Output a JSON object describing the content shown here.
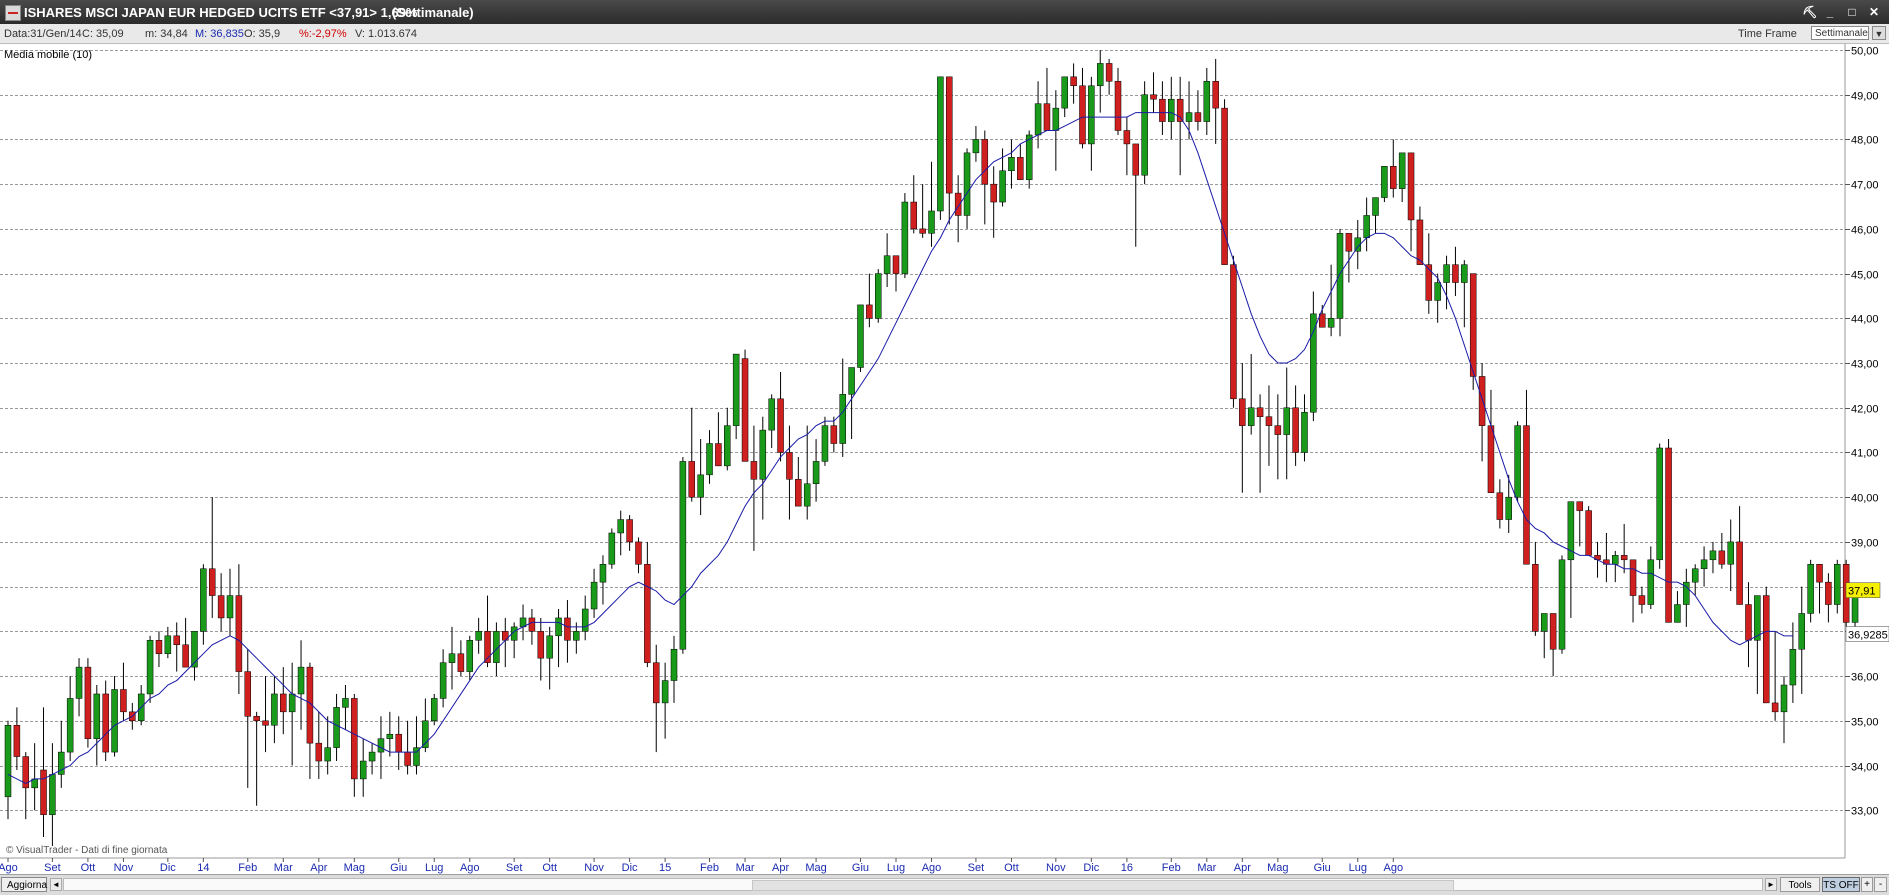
{
  "window": {
    "title": "ISHARES MSCI JAPAN EUR HEDGED UCITS ETF <37,91> 1,69%",
    "timeframe": "(Settimanale)",
    "buttons": {
      "tools": "⛏",
      "minimize": "_",
      "maximize": "□",
      "close": "✕"
    }
  },
  "infobar": {
    "date": "Data:31/Gen/14",
    "close": "C: 35,09",
    "min": "m: 34,84",
    "max": "M: 36,835",
    "open": "O: 35,9",
    "change": "%:-2,97%",
    "volume": "V: 1.013.674",
    "timeframe_label": "Time Frame",
    "timeframe_value": "Settimanale",
    "dropdown_icon": "▼"
  },
  "indicator_label": "Media mobile (10)",
  "watermark": "© VisualTrader - Dati di fine giornata",
  "bottombar": {
    "refresh": "Aggiorna",
    "tools": "Tools",
    "ts_off": "TS OFF",
    "plus": "+",
    "minus": "-",
    "scroll_left": "◄",
    "scroll_right": "►"
  },
  "colors": {
    "up": "#1a9a1a",
    "down": "#d01f1f",
    "ma": "#1a1aa8",
    "grid": "#9a9a9a",
    "last_price_bg": "#f5ef00"
  },
  "chart_data": {
    "type": "candlestick",
    "series_name": "Media mobile (10)",
    "ylim": [
      32.2,
      50.0
    ],
    "y_ticks": [
      "33,00",
      "34,00",
      "35,00",
      "36,00",
      "37,00",
      "38,00",
      "39,00",
      "40,00",
      "41,00",
      "42,00",
      "43,00",
      "44,00",
      "45,00",
      "46,00",
      "47,00",
      "48,00",
      "49,00",
      "50,00"
    ],
    "x_labels": [
      "Ago",
      "Set",
      "Ott",
      "Nov",
      "Dic",
      "14",
      "Feb",
      "Mar",
      "Apr",
      "Mag",
      "Giu",
      "Lug",
      "Ago",
      "Set",
      "Ott",
      "Nov",
      "Dic",
      "15",
      "Feb",
      "Mar",
      "Apr",
      "Mag",
      "Giu",
      "Lug",
      "Ago",
      "Set",
      "Ott",
      "Nov",
      "Dic",
      "16",
      "Feb",
      "Mar",
      "Apr",
      "Mag",
      "Giu",
      "Lug",
      "Ago"
    ],
    "x_label_index": [
      0,
      5,
      9,
      13,
      18,
      22,
      27,
      31,
      35,
      39,
      44,
      48,
      52,
      57,
      61,
      66,
      70,
      74,
      79,
      83,
      87,
      91,
      96,
      100,
      104,
      109,
      113,
      118,
      122,
      126,
      131,
      135,
      139,
      143,
      148,
      152,
      156
    ],
    "last_price_label": "37,91",
    "ma_label": "36,9285",
    "last_price": 37.91,
    "ma_last": 36.9285,
    "candles": [
      [
        33.3,
        35.0,
        32.8,
        34.9
      ],
      [
        34.9,
        35.3,
        33.9,
        34.2
      ],
      [
        34.2,
        34.3,
        32.8,
        33.5
      ],
      [
        33.5,
        34.5,
        33.0,
        33.7
      ],
      [
        33.9,
        35.3,
        32.4,
        32.9
      ],
      [
        32.9,
        34.5,
        32.2,
        33.8
      ],
      [
        33.8,
        35.0,
        33.5,
        34.3
      ],
      [
        34.3,
        36.0,
        34.1,
        35.5
      ],
      [
        35.5,
        36.4,
        35.1,
        36.2
      ],
      [
        36.2,
        36.4,
        34.4,
        34.6
      ],
      [
        34.6,
        35.8,
        34.0,
        35.6
      ],
      [
        35.6,
        35.9,
        34.1,
        34.3
      ],
      [
        34.3,
        36.0,
        34.2,
        35.7
      ],
      [
        35.7,
        36.3,
        35.0,
        35.2
      ],
      [
        35.2,
        35.4,
        34.8,
        35.0
      ],
      [
        35.0,
        35.8,
        34.9,
        35.6
      ],
      [
        35.6,
        36.9,
        35.4,
        36.8
      ],
      [
        36.8,
        37.0,
        36.2,
        36.5
      ],
      [
        36.5,
        37.1,
        36.4,
        36.9
      ],
      [
        36.9,
        37.2,
        36.1,
        36.7
      ],
      [
        36.7,
        37.3,
        36.3,
        36.2
      ],
      [
        36.2,
        37.0,
        35.9,
        37.0
      ],
      [
        37.0,
        38.5,
        36.7,
        38.4
      ],
      [
        38.4,
        40.0,
        37.3,
        37.8
      ],
      [
        37.8,
        38.3,
        37.0,
        37.3
      ],
      [
        37.3,
        38.4,
        36.9,
        37.8
      ],
      [
        37.8,
        38.5,
        35.6,
        36.1
      ],
      [
        36.1,
        36.6,
        33.5,
        35.1
      ],
      [
        35.1,
        35.2,
        33.1,
        35.0
      ],
      [
        35.0,
        36.0,
        34.3,
        34.9
      ],
      [
        34.9,
        36.0,
        34.5,
        35.6
      ],
      [
        35.6,
        36.2,
        34.7,
        35.2
      ],
      [
        35.2,
        36.3,
        34.0,
        35.6
      ],
      [
        35.6,
        36.8,
        34.8,
        36.2
      ],
      [
        36.2,
        36.3,
        33.7,
        34.5
      ],
      [
        34.5,
        35.2,
        33.7,
        34.1
      ],
      [
        34.1,
        35.1,
        33.8,
        34.4
      ],
      [
        34.4,
        35.6,
        34.1,
        35.3
      ],
      [
        35.3,
        35.8,
        34.8,
        35.5
      ],
      [
        35.5,
        35.6,
        33.3,
        33.7
      ],
      [
        33.7,
        34.6,
        33.3,
        34.1
      ],
      [
        34.1,
        34.5,
        33.8,
        34.3
      ],
      [
        34.3,
        35.1,
        33.7,
        34.6
      ],
      [
        34.6,
        35.2,
        34.2,
        34.7
      ],
      [
        34.7,
        35.1,
        33.9,
        34.3
      ],
      [
        34.3,
        35.0,
        33.8,
        34.0
      ],
      [
        34.0,
        35.1,
        33.8,
        34.4
      ],
      [
        34.4,
        35.5,
        34.3,
        35.0
      ],
      [
        35.0,
        35.6,
        34.9,
        35.5
      ],
      [
        35.5,
        36.6,
        35.3,
        36.3
      ],
      [
        36.3,
        37.1,
        35.7,
        36.5
      ],
      [
        36.5,
        36.8,
        36.0,
        36.1
      ],
      [
        36.1,
        36.9,
        35.9,
        36.8
      ],
      [
        36.8,
        37.3,
        36.5,
        37.0
      ],
      [
        37.0,
        37.8,
        36.2,
        36.3
      ],
      [
        36.3,
        37.2,
        36.0,
        37.0
      ],
      [
        37.0,
        37.3,
        36.2,
        36.8
      ],
      [
        36.8,
        37.2,
        36.4,
        37.1
      ],
      [
        37.1,
        37.6,
        36.8,
        37.3
      ],
      [
        37.3,
        37.5,
        36.7,
        37.0
      ],
      [
        37.0,
        37.3,
        35.9,
        36.4
      ],
      [
        36.4,
        37.1,
        35.7,
        36.9
      ],
      [
        36.9,
        37.5,
        36.2,
        37.3
      ],
      [
        37.3,
        37.7,
        36.3,
        36.8
      ],
      [
        36.8,
        37.2,
        36.5,
        37.0
      ],
      [
        37.0,
        37.8,
        36.8,
        37.5
      ],
      [
        37.5,
        38.4,
        37.3,
        38.1
      ],
      [
        38.1,
        38.7,
        37.6,
        38.5
      ],
      [
        38.5,
        39.3,
        38.4,
        39.2
      ],
      [
        39.2,
        39.7,
        38.7,
        39.5
      ],
      [
        39.5,
        39.6,
        38.8,
        39.0
      ],
      [
        39.0,
        39.1,
        38.3,
        38.5
      ],
      [
        38.5,
        39.0,
        36.2,
        36.3
      ],
      [
        36.3,
        36.7,
        34.3,
        35.4
      ],
      [
        35.4,
        36.3,
        34.6,
        35.9
      ],
      [
        35.9,
        36.9,
        35.4,
        36.6
      ],
      [
        36.6,
        40.9,
        36.5,
        40.8
      ],
      [
        40.8,
        42.0,
        39.9,
        40.0
      ],
      [
        40.0,
        41.3,
        39.6,
        40.5
      ],
      [
        40.5,
        41.5,
        40.3,
        41.2
      ],
      [
        41.2,
        41.9,
        40.7,
        40.7
      ],
      [
        40.7,
        42.0,
        40.6,
        41.6
      ],
      [
        41.6,
        43.1,
        41.3,
        43.2
      ],
      [
        43.1,
        43.3,
        41.0,
        40.8
      ],
      [
        40.8,
        41.6,
        38.8,
        40.4
      ],
      [
        40.4,
        41.8,
        39.5,
        41.5
      ],
      [
        41.5,
        42.3,
        41.1,
        42.2
      ],
      [
        42.2,
        42.8,
        40.8,
        41.0
      ],
      [
        41.0,
        41.6,
        39.5,
        40.4
      ],
      [
        40.4,
        40.9,
        39.9,
        39.8
      ],
      [
        39.8,
        41.6,
        39.5,
        40.3
      ],
      [
        40.3,
        41.3,
        39.9,
        40.8
      ],
      [
        40.8,
        41.8,
        40.7,
        41.6
      ],
      [
        41.6,
        41.8,
        41.0,
        41.2
      ],
      [
        41.2,
        43.1,
        40.9,
        42.3
      ],
      [
        42.3,
        42.6,
        41.3,
        42.9
      ],
      [
        42.9,
        44.3,
        42.8,
        44.3
      ],
      [
        44.3,
        45.0,
        43.8,
        44.0
      ],
      [
        44.0,
        45.1,
        43.9,
        45.0
      ],
      [
        45.0,
        45.9,
        44.7,
        45.4
      ],
      [
        45.4,
        45.3,
        44.6,
        45.0
      ],
      [
        45.0,
        46.8,
        44.9,
        46.6
      ],
      [
        46.6,
        47.2,
        45.9,
        46.0
      ],
      [
        46.0,
        47.0,
        45.8,
        45.9
      ],
      [
        45.9,
        47.5,
        45.6,
        46.4
      ],
      [
        46.4,
        49.4,
        46.2,
        49.4
      ],
      [
        49.4,
        47.1,
        46.1,
        46.8
      ],
      [
        46.8,
        47.2,
        45.7,
        46.3
      ],
      [
        46.3,
        47.8,
        46.0,
        47.7
      ],
      [
        47.7,
        48.3,
        47.5,
        48.0
      ],
      [
        48.0,
        48.2,
        46.1,
        47.0
      ],
      [
        47.0,
        47.4,
        45.8,
        46.6
      ],
      [
        46.6,
        47.8,
        46.5,
        47.3
      ],
      [
        47.3,
        48.0,
        46.9,
        47.6
      ],
      [
        47.6,
        47.9,
        47.1,
        47.1
      ],
      [
        47.1,
        48.2,
        46.9,
        48.1
      ],
      [
        48.1,
        49.3,
        47.8,
        48.8
      ],
      [
        48.8,
        49.6,
        48.2,
        48.2
      ],
      [
        48.2,
        49.1,
        47.3,
        48.7
      ],
      [
        48.7,
        49.4,
        48.5,
        49.4
      ],
      [
        49.4,
        49.7,
        48.8,
        49.2
      ],
      [
        49.2,
        49.6,
        47.8,
        47.9
      ],
      [
        47.9,
        49.4,
        47.3,
        49.2
      ],
      [
        49.2,
        50.0,
        48.6,
        49.7
      ],
      [
        49.7,
        49.8,
        49.0,
        49.3
      ],
      [
        49.3,
        49.6,
        48.1,
        48.2
      ],
      [
        48.2,
        48.5,
        47.2,
        47.9
      ],
      [
        47.9,
        47.5,
        45.6,
        47.2
      ],
      [
        47.2,
        49.3,
        47.0,
        49.0
      ],
      [
        49.0,
        49.5,
        48.6,
        48.9
      ],
      [
        48.9,
        49.3,
        48.1,
        48.4
      ],
      [
        48.4,
        49.4,
        48.0,
        48.9
      ],
      [
        48.9,
        49.4,
        47.2,
        48.4
      ],
      [
        48.4,
        49.3,
        48.0,
        48.6
      ],
      [
        48.6,
        49.1,
        48.2,
        48.4
      ],
      [
        48.4,
        49.6,
        48.1,
        49.3
      ],
      [
        49.3,
        49.8,
        47.9,
        48.7
      ],
      [
        48.7,
        48.9,
        45.4,
        45.2
      ],
      [
        45.2,
        45.4,
        42.0,
        42.2
      ],
      [
        42.2,
        43.0,
        40.1,
        41.6
      ],
      [
        41.6,
        43.2,
        41.4,
        42.0
      ],
      [
        42.0,
        42.3,
        40.1,
        41.8
      ],
      [
        41.8,
        42.5,
        40.7,
        41.6
      ],
      [
        41.6,
        42.3,
        40.4,
        41.4
      ],
      [
        41.4,
        42.9,
        40.4,
        42.0
      ],
      [
        42.0,
        42.5,
        40.7,
        41.0
      ],
      [
        41.0,
        42.3,
        40.8,
        41.9
      ],
      [
        41.9,
        44.6,
        41.7,
        44.1
      ],
      [
        44.1,
        44.3,
        43.8,
        43.8
      ],
      [
        43.8,
        45.2,
        43.6,
        44.0
      ],
      [
        44.0,
        46.0,
        43.6,
        45.9
      ],
      [
        45.9,
        45.2,
        44.8,
        45.5
      ],
      [
        45.5,
        46.2,
        45.1,
        45.8
      ],
      [
        45.8,
        46.7,
        45.5,
        46.3
      ],
      [
        46.3,
        46.4,
        45.9,
        46.7
      ],
      [
        46.7,
        47.3,
        46.6,
        47.4
      ],
      [
        47.4,
        48.0,
        46.7,
        46.9
      ],
      [
        46.9,
        47.7,
        46.6,
        47.7
      ],
      [
        47.7,
        47.6,
        45.5,
        46.2
      ],
      [
        46.2,
        46.5,
        45.5,
        45.2
      ],
      [
        45.2,
        45.9,
        44.1,
        44.4
      ],
      [
        44.4,
        45.0,
        43.9,
        44.8
      ],
      [
        44.8,
        45.4,
        44.2,
        45.2
      ],
      [
        45.2,
        45.6,
        44.5,
        44.8
      ],
      [
        44.8,
        45.3,
        43.8,
        45.2
      ],
      [
        45.0,
        44.6,
        42.4,
        42.7
      ],
      [
        42.7,
        43.0,
        40.8,
        41.6
      ],
      [
        41.6,
        42.4,
        40.3,
        40.1
      ],
      [
        40.1,
        40.4,
        39.3,
        39.5
      ],
      [
        39.5,
        40.5,
        39.2,
        40.0
      ],
      [
        40.0,
        41.7,
        39.9,
        41.6
      ],
      [
        41.6,
        42.4,
        38.8,
        38.5
      ],
      [
        38.5,
        39.0,
        36.9,
        37.0
      ],
      [
        37.0,
        37.4,
        36.4,
        37.4
      ],
      [
        37.4,
        37.3,
        36.0,
        36.6
      ],
      [
        36.6,
        38.7,
        36.5,
        38.6
      ],
      [
        38.6,
        39.9,
        37.3,
        39.9
      ],
      [
        39.9,
        39.4,
        38.9,
        39.7
      ],
      [
        39.7,
        39.8,
        38.8,
        38.7
      ],
      [
        38.7,
        39.0,
        38.2,
        38.6
      ],
      [
        38.6,
        39.2,
        38.1,
        38.5
      ],
      [
        38.5,
        38.8,
        38.1,
        38.7
      ],
      [
        38.7,
        39.4,
        38.3,
        38.6
      ],
      [
        38.6,
        38.5,
        37.2,
        37.8
      ],
      [
        37.8,
        38.0,
        37.4,
        37.6
      ],
      [
        37.6,
        38.9,
        37.5,
        38.6
      ],
      [
        38.6,
        41.2,
        38.4,
        41.1
      ],
      [
        41.1,
        41.3,
        37.8,
        37.2
      ],
      [
        37.2,
        37.9,
        37.3,
        37.6
      ],
      [
        37.6,
        38.4,
        37.1,
        38.1
      ],
      [
        38.1,
        38.5,
        37.8,
        38.4
      ],
      [
        38.4,
        38.9,
        38.0,
        38.6
      ],
      [
        38.6,
        39.0,
        38.3,
        38.8
      ],
      [
        38.8,
        39.2,
        38.4,
        38.5
      ],
      [
        38.5,
        39.5,
        37.9,
        39.0
      ],
      [
        39.0,
        39.8,
        37.7,
        37.6
      ],
      [
        37.6,
        38.1,
        36.2,
        36.8
      ],
      [
        36.8,
        37.6,
        35.6,
        37.8
      ],
      [
        37.8,
        38.0,
        35.5,
        35.4
      ],
      [
        35.4,
        37.0,
        35.0,
        35.2
      ],
      [
        35.2,
        36.0,
        34.5,
        35.8
      ],
      [
        35.8,
        37.2,
        35.4,
        36.6
      ],
      [
        36.6,
        38.0,
        35.6,
        37.4
      ],
      [
        37.4,
        38.6,
        37.2,
        38.5
      ],
      [
        38.5,
        38.4,
        37.4,
        38.1
      ],
      [
        38.1,
        38.3,
        37.2,
        37.6
      ],
      [
        37.6,
        38.6,
        37.4,
        38.5
      ],
      [
        38.5,
        38.6,
        37.1,
        37.2
      ],
      [
        37.2,
        38.0,
        37.1,
        37.91
      ]
    ],
    "ma": [
      33.8,
      33.7,
      33.6,
      33.7,
      33.7,
      33.8,
      33.9,
      34.0,
      34.2,
      34.3,
      34.5,
      34.7,
      34.9,
      35.0,
      35.1,
      35.3,
      35.5,
      35.6,
      35.8,
      35.9,
      36.1,
      36.3,
      36.5,
      36.7,
      36.8,
      36.9,
      36.8,
      36.6,
      36.4,
      36.2,
      36.0,
      35.8,
      35.6,
      35.5,
      35.4,
      35.2,
      35.0,
      34.9,
      34.8,
      34.7,
      34.6,
      34.5,
      34.4,
      34.3,
      34.3,
      34.3,
      34.3,
      34.5,
      34.7,
      35.0,
      35.3,
      35.6,
      35.9,
      36.2,
      36.4,
      36.6,
      36.8,
      37.0,
      37.1,
      37.2,
      37.2,
      37.2,
      37.2,
      37.1,
      37.1,
      37.1,
      37.2,
      37.4,
      37.6,
      37.8,
      38.0,
      38.1,
      38.0,
      37.9,
      37.7,
      37.6,
      37.8,
      38.0,
      38.3,
      38.5,
      38.7,
      39.0,
      39.4,
      39.8,
      40.1,
      40.3,
      40.6,
      40.9,
      41.1,
      41.3,
      41.4,
      41.6,
      41.7,
      41.7,
      41.9,
      42.2,
      42.5,
      42.8,
      43.1,
      43.5,
      43.9,
      44.3,
      44.7,
      45.1,
      45.5,
      45.8,
      46.2,
      46.5,
      46.8,
      47.1,
      47.3,
      47.5,
      47.6,
      47.7,
      47.9,
      48.0,
      48.1,
      48.2,
      48.2,
      48.3,
      48.4,
      48.5,
      48.5,
      48.5,
      48.5,
      48.5,
      48.5,
      48.6,
      48.6,
      48.6,
      48.6,
      48.6,
      48.5,
      48.2,
      47.7,
      47.1,
      46.5,
      45.9,
      45.3,
      44.7,
      44.1,
      43.6,
      43.2,
      43.0,
      43.0,
      43.1,
      43.3,
      43.7,
      44.2,
      44.6,
      45.0,
      45.3,
      45.6,
      45.8,
      45.9,
      45.9,
      45.8,
      45.6,
      45.4,
      45.3,
      45.1,
      44.9,
      44.5,
      44.0,
      43.4,
      42.8,
      42.2,
      41.6,
      41.0,
      40.4,
      39.9,
      39.5,
      39.3,
      39.2,
      39.0,
      38.9,
      38.8,
      38.7,
      38.7,
      38.6,
      38.5,
      38.5,
      38.4,
      38.4,
      38.3,
      38.3,
      38.2,
      38.1,
      38.1,
      38.0,
      37.8,
      37.5,
      37.2,
      37.0,
      36.8,
      36.7,
      36.8,
      36.9,
      37.0,
      37.0,
      36.9,
      36.9
    ]
  }
}
